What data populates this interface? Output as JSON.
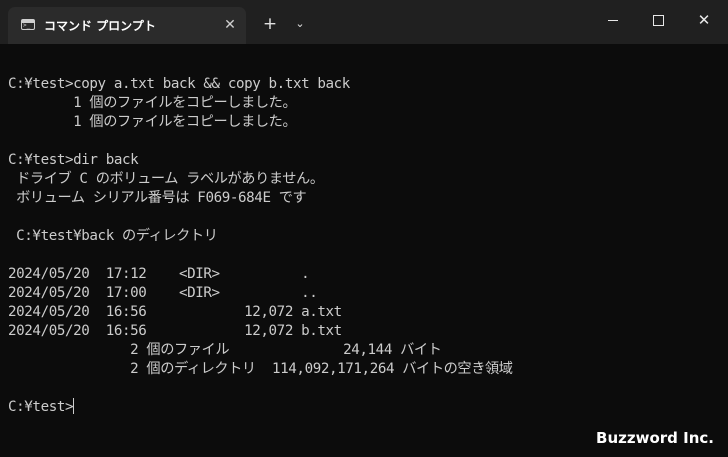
{
  "titlebar": {
    "tab_title": "コマンド プロンプト",
    "tab_icon": "command-prompt-icon",
    "close_tab_glyph": "✕",
    "new_tab_glyph": "+",
    "dropdown_glyph": "⌄",
    "window_close_glyph": "✕"
  },
  "terminal": {
    "lines": [
      "",
      "C:¥test>copy a.txt back && copy b.txt back",
      "        1 個のファイルをコピーしました。",
      "        1 個のファイルをコピーしました。",
      "",
      "C:¥test>dir back",
      " ドライブ C のボリューム ラベルがありません。",
      " ボリューム シリアル番号は F069-684E です",
      "",
      " C:¥test¥back のディレクトリ",
      "",
      "2024/05/20  17:12    <DIR>          .",
      "2024/05/20  17:00    <DIR>          ..",
      "2024/05/20  16:56            12,072 a.txt",
      "2024/05/20  16:56            12,072 b.txt",
      "               2 個のファイル              24,144 バイト",
      "               2 個のディレクトリ  114,092,171,264 バイトの空き領域",
      ""
    ],
    "prompt": "C:¥test>"
  },
  "watermark": "Buzzword Inc."
}
